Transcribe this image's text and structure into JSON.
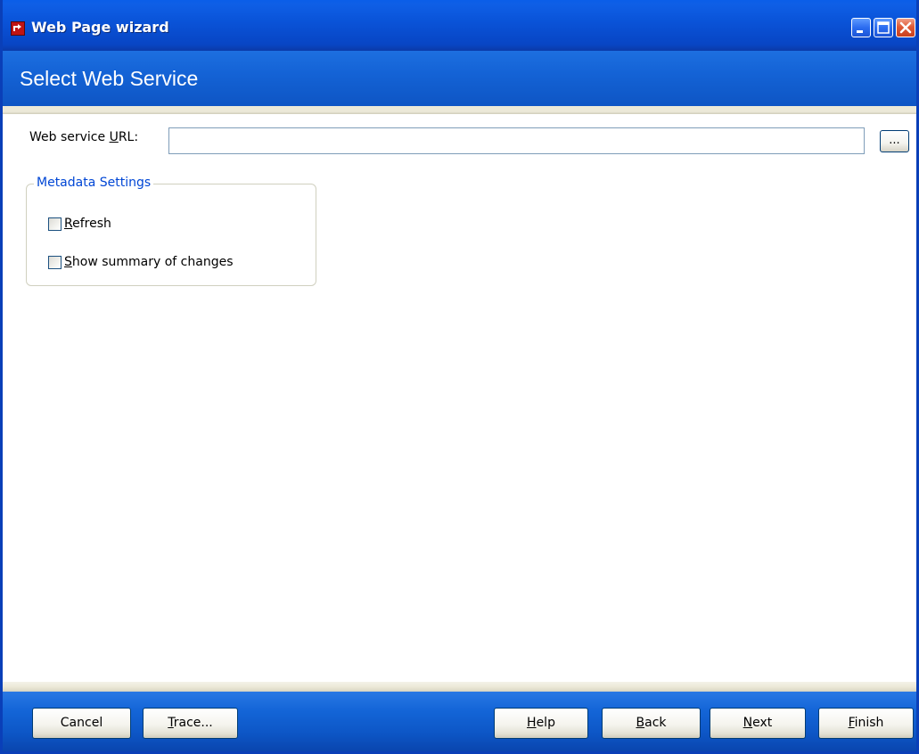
{
  "window": {
    "title": "Web Page wizard",
    "controls": {
      "minimize_icon": "minimize-icon",
      "maximize_icon": "maximize-icon",
      "close_icon": "close-icon"
    }
  },
  "header": {
    "title": "Select Web Service"
  },
  "url_field": {
    "label_prefix": "Web service ",
    "label_accel": "U",
    "label_suffix": "RL:",
    "value": "",
    "browse_label": "..."
  },
  "metadata": {
    "legend": "Metadata Settings",
    "options": [
      {
        "accel": "R",
        "rest": "efresh",
        "checked": false
      },
      {
        "accel": "S",
        "rest": "how summary of changes",
        "checked": false
      }
    ]
  },
  "buttons": {
    "cancel": {
      "label": "Cancel"
    },
    "trace": {
      "accel": "T",
      "rest": "race..."
    },
    "help": {
      "accel": "H",
      "rest": "elp"
    },
    "back": {
      "accel": "B",
      "rest": "ack"
    },
    "next": {
      "accel": "N",
      "rest": "ext"
    },
    "finish": {
      "accel": "F",
      "rest": "inish"
    }
  },
  "colors": {
    "title_bar": "#0a54d9",
    "header_band": "#1463d6",
    "legend_text": "#0046d5",
    "close_button": "#e05a36"
  }
}
